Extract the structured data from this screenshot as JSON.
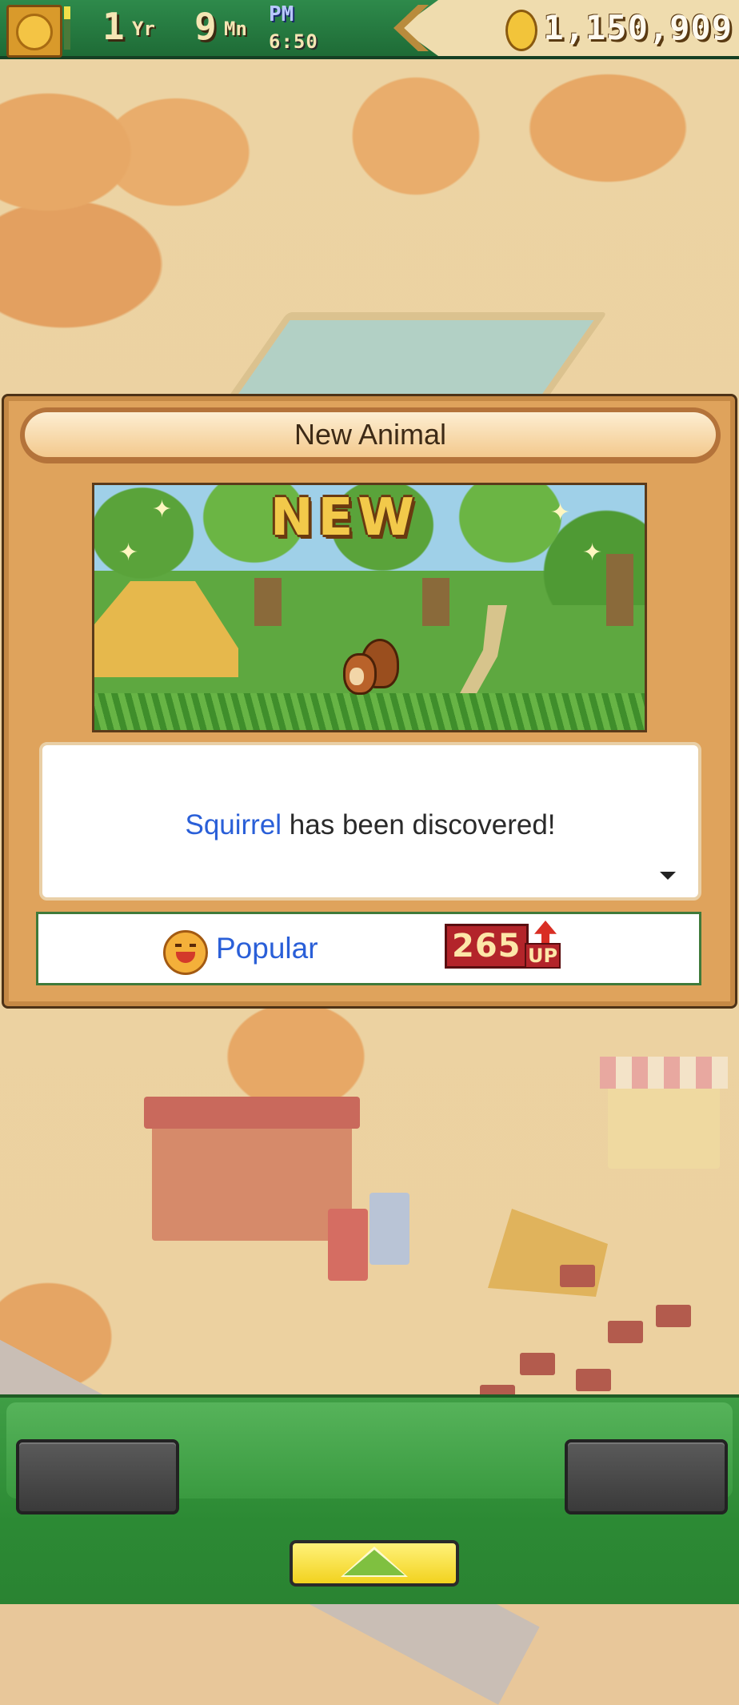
{
  "hud": {
    "year": "1",
    "year_unit": "Yr",
    "month": "9",
    "month_unit": "Mn",
    "am_pm": "PM",
    "time": "6:50",
    "money": "1,150,909",
    "icons": {
      "menu": "fruit-icon",
      "back": "chevron-left-icon",
      "coin": "coin-icon"
    }
  },
  "dialog": {
    "title": "New Animal",
    "scene_badge": "NEW",
    "message": {
      "animal": "Squirrel",
      "text": " has been discovered!"
    },
    "stat": {
      "label": "Popular",
      "value": "265",
      "change": "UP",
      "icons": {
        "face": "happy-face-icon",
        "change": "up-arrow-icon"
      }
    }
  },
  "colors": {
    "hud_green": "#1e6b36",
    "dialog_frame": "#dfa35c",
    "link_blue": "#2a5fd8",
    "panel_green": "#2c8a34",
    "expand_yellow": "#f2d21e"
  }
}
